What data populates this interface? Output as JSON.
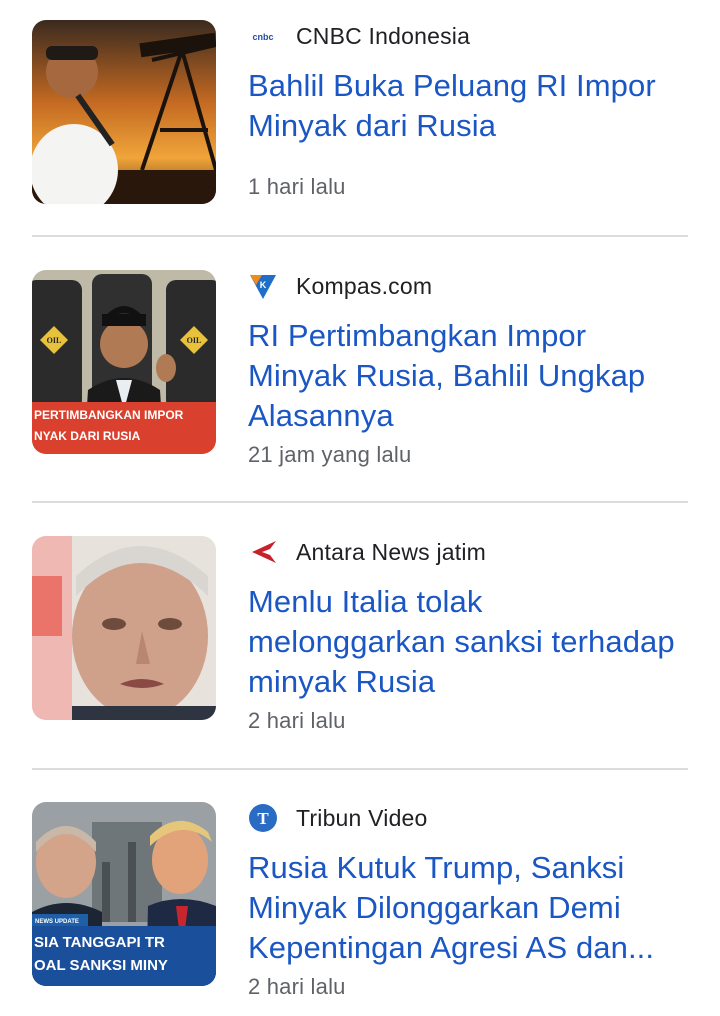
{
  "articles": [
    {
      "source": "CNBC Indonesia",
      "logo_icon": "cnbc-logo-icon",
      "logo_text": "cnbc",
      "headline": "Bahlil Buka Peluang RI Impor Minyak dari Rusia",
      "time": "1 hari lalu",
      "thumbnail": "oil-pump-thumbnail"
    },
    {
      "source": "Kompas.com",
      "logo_icon": "kompas-logo-icon",
      "logo_text": "K",
      "headline": "RI Pertimbangkan Impor Minyak Rusia, Bahlil Ungkap Alasannya",
      "time": "21 jam yang lalu",
      "thumbnail": "oil-barrels-thumbnail",
      "thumb_caption": [
        "PERTIMBANGKAN IMPOR",
        "NYAK DARI RUSIA"
      ],
      "barrel_label": "OIL"
    },
    {
      "source": "Antara News jatim",
      "logo_icon": "antara-logo-icon",
      "headline": "Menlu Italia tolak melonggarkan sanksi terhadap minyak Rusia",
      "time": "2 hari lalu",
      "thumbnail": "portrait-thumbnail"
    },
    {
      "source": "Tribun Video",
      "logo_icon": "tribun-logo-icon",
      "logo_text": "T",
      "headline": "Rusia Kutuk Trump, Sanksi Minyak Dilonggarkan Demi Kepentingan Agresi AS dan...",
      "time": "2 hari lalu",
      "thumbnail": "two-leaders-thumbnail",
      "thumb_caption": [
        "SIA TANGGAPI TR",
        "OAL SANKSI MINY"
      ],
      "thumb_tag": "NEWS UPDATE"
    }
  ],
  "colors": {
    "headline": "#1a57c4",
    "source": "#202124",
    "time": "#5f6368",
    "divider": "#dcdcdc"
  }
}
